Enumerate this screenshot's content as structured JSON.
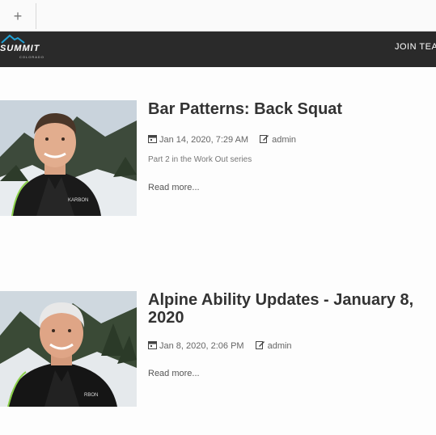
{
  "browser": {
    "new_tab_glyph": "+"
  },
  "nav": {
    "logo_text": "SUMMIT",
    "logo_sub": "COLORADO",
    "join_label": "JOIN TEA"
  },
  "posts": [
    {
      "title": "Bar Patterns: Back Squat",
      "date": "Jan 14, 2020, 7:29 AM",
      "author": "admin",
      "excerpt": "Part 2 in the Work Out series",
      "read_more": "Read more..."
    },
    {
      "title": "Alpine Ability Updates - January 8, 2020",
      "date": "Jan 8, 2020, 2:06 PM",
      "author": "admin",
      "excerpt": "",
      "read_more": "Read more..."
    }
  ],
  "colors": {
    "navbar": "#2a2a2a",
    "accent": "#1fa3d8",
    "jacket_trim": "#8bd14a"
  },
  "icons": {
    "date": "calendar-icon",
    "author": "edit-icon",
    "new_tab": "plus-icon"
  }
}
